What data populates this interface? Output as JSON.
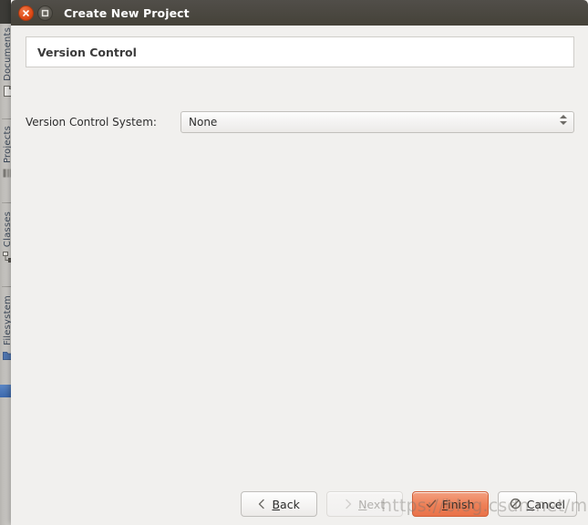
{
  "window": {
    "title": "Create New Project",
    "titlebar_bg": "#48453e",
    "close_button": {
      "name": "close",
      "color": "#dd4814",
      "glyph": "×"
    },
    "maximize_button": {
      "name": "maximize",
      "color": "#56534c",
      "glyph": "□"
    }
  },
  "page": {
    "header_title": "Version Control",
    "body_bg": "#f1f0ee"
  },
  "form": {
    "rows": [
      {
        "label": "Version Control System:",
        "control": "combobox",
        "value": "None",
        "options": [
          "None"
        ]
      }
    ]
  },
  "buttons": [
    {
      "id": "back",
      "label": "Back",
      "mnemonic": "B",
      "icon": "chevron-left-icon",
      "state": "enabled",
      "default": false
    },
    {
      "id": "next",
      "label": "Next",
      "mnemonic": "N",
      "icon": "chevron-right-icon",
      "state": "disabled",
      "default": false
    },
    {
      "id": "finish",
      "label": "Finish",
      "mnemonic": "F",
      "icon": "check-icon",
      "state": "enabled",
      "default": true
    },
    {
      "id": "cancel",
      "label": "Cancel",
      "mnemonic": "C",
      "icon": "no-entry-icon",
      "state": "enabled",
      "default": false
    }
  ],
  "sidebar": {
    "items": [
      {
        "label": "Documents",
        "icon": "documents-icon",
        "active": false
      },
      {
        "label": "Projects",
        "icon": "projects-icon",
        "active": false
      },
      {
        "label": "Classes",
        "icon": "classes-icon",
        "active": false
      },
      {
        "label": "Filesystem",
        "icon": "filesystem-icon",
        "active": true
      }
    ]
  },
  "watermark": {
    "text": "https://blog.csdn.net/maxuezaozap"
  },
  "colors": {
    "accent_orange": "#dd4814",
    "default_button": "#ee7f56",
    "titlebar": "#48453e",
    "dialog_bg": "#f1f0ee",
    "sidebar_active": "#3c69ae"
  }
}
